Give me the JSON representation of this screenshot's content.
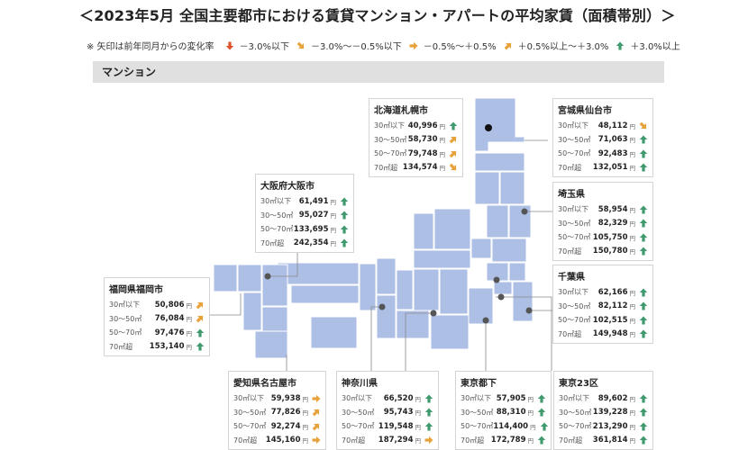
{
  "title": "＜2023年5月 全国主要都市における賃貸マンション・アパートの平均家賃（面積帯別）＞",
  "legend": {
    "note": "※ 矢印は前年同月からの変化率",
    "items": [
      {
        "label": "－3.0%以下",
        "kind": "down",
        "color": "#e0502a"
      },
      {
        "label": "－3.0%～－0.5%以下",
        "kind": "diag-down",
        "color": "#e8a23c"
      },
      {
        "label": "－0.5%～＋0.5%",
        "kind": "right",
        "color": "#e8a23c"
      },
      {
        "label": "＋0.5%以上～＋3.0%",
        "kind": "diag-up",
        "color": "#e8a23c"
      },
      {
        "label": "＋3.0%以上",
        "kind": "up",
        "color": "#3f9a6e"
      }
    ]
  },
  "section_label": "マンション",
  "unit": "円",
  "row_labels": [
    "30㎡以下",
    "30～50㎡",
    "50～70㎡",
    "70㎡超"
  ],
  "cities": {
    "sapporo": {
      "name": "北海道札幌市",
      "values": [
        "40,996",
        "58,730",
        "79,748",
        "134,574"
      ],
      "trends": [
        "up",
        "diag-up",
        "diag-up",
        "diag-down"
      ]
    },
    "sendai": {
      "name": "宮城県仙台市",
      "values": [
        "48,112",
        "71,063",
        "92,483",
        "132,051"
      ],
      "trends": [
        "diag-down",
        "up",
        "up",
        "up"
      ]
    },
    "osaka": {
      "name": "大阪府大阪市",
      "values": [
        "61,491",
        "95,027",
        "133,695",
        "242,354"
      ],
      "trends": [
        "up",
        "up",
        "up",
        "up"
      ]
    },
    "saitama": {
      "name": "埼玉県",
      "values": [
        "58,954",
        "82,329",
        "105,750",
        "150,780"
      ],
      "trends": [
        "up",
        "up",
        "up",
        "up"
      ]
    },
    "fukuoka": {
      "name": "福岡県福岡市",
      "values": [
        "50,806",
        "76,084",
        "97,476",
        "153,140"
      ],
      "trends": [
        "diag-up",
        "diag-up",
        "up",
        "up"
      ]
    },
    "chiba": {
      "name": "千葉県",
      "values": [
        "62,166",
        "82,112",
        "102,515",
        "149,948"
      ],
      "trends": [
        "up",
        "up",
        "up",
        "up"
      ]
    },
    "nagoya": {
      "name": "愛知県名古屋市",
      "values": [
        "59,938",
        "77,826",
        "92,274",
        "145,160"
      ],
      "trends": [
        "right",
        "diag-up",
        "diag-up",
        "right"
      ]
    },
    "kanagawa": {
      "name": "神奈川県",
      "values": [
        "66,520",
        "95,743",
        "119,548",
        "187,294"
      ],
      "trends": [
        "up",
        "up",
        "up",
        "right"
      ]
    },
    "tokyo": {
      "name": "東京都下",
      "values": [
        "57,905",
        "88,310",
        "114,400",
        "172,789"
      ],
      "trends": [
        "up",
        "up",
        "up",
        "up"
      ]
    },
    "tokyo23": {
      "name": "東京23区",
      "values": [
        "89,602",
        "139,228",
        "213,290",
        "361,814"
      ],
      "trends": [
        "up",
        "up",
        "up",
        "up"
      ]
    }
  }
}
